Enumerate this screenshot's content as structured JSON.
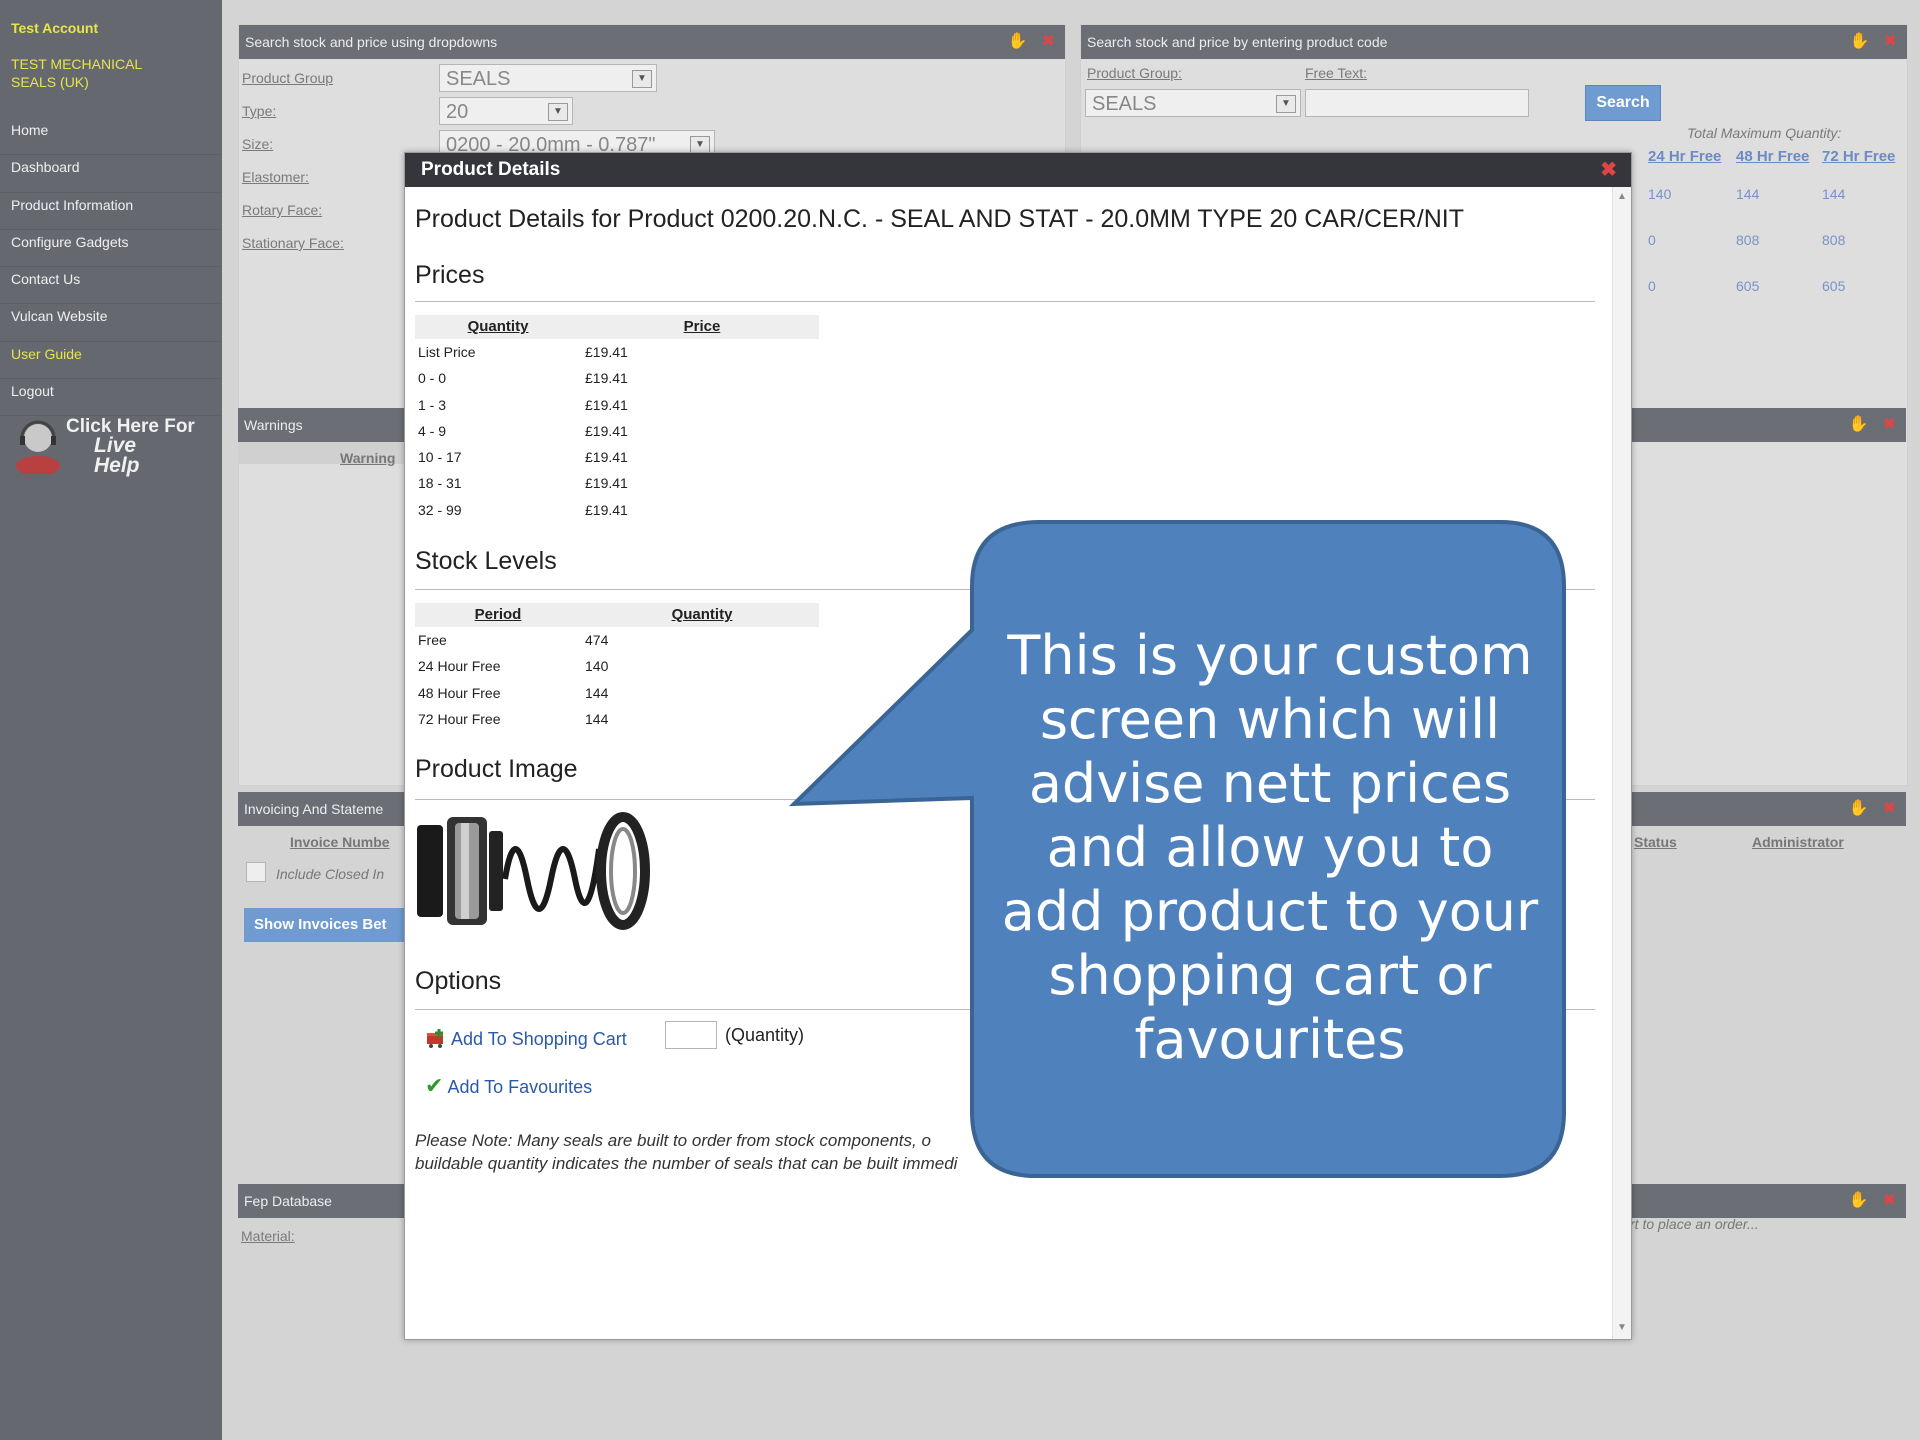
{
  "sidebar": {
    "account": "Test Account",
    "company": "TEST MECHANICAL SEALS (UK)",
    "items": [
      {
        "label": "Home"
      },
      {
        "label": "Dashboard"
      },
      {
        "label": "Product Information"
      },
      {
        "label": "Configure Gadgets"
      },
      {
        "label": "Contact Us"
      },
      {
        "label": "Vulcan Website"
      },
      {
        "label": "User Guide"
      },
      {
        "label": "Logout"
      }
    ],
    "live_help_1": "Click Here For",
    "live_help_2": "Live Help"
  },
  "panel_dropdowns": {
    "title": "Search stock and price using dropdowns",
    "labels": [
      "Product Group",
      "Type:",
      "Size:",
      "Elastomer:",
      "Rotary Face:",
      "Stationary Face:"
    ],
    "product_group": "SEALS",
    "type": "20",
    "size": "0200 - 20.0mm - 0.787\""
  },
  "panel_code": {
    "title": "Search stock and price by entering product code",
    "product_group_label": "Product Group:",
    "free_text_label": "Free Text:",
    "product_group_value": "SEALS",
    "search_button": "Search",
    "total_max_label": "Total Maximum Quantity:",
    "cols": [
      "24 Hr Free",
      "48 Hr Free",
      "72 Hr Free"
    ],
    "rows": [
      [
        "140",
        "144",
        "144"
      ],
      [
        "0",
        "808",
        "808"
      ],
      [
        "0",
        "605",
        "605"
      ]
    ]
  },
  "panel_warnings": {
    "title": "Warnings",
    "col": "Warning"
  },
  "panel_invoicing": {
    "title": "Invoicing And Stateme",
    "col_invoice": "Invoice Numbe",
    "include_closed": "Include Closed In",
    "show_button": "Show Invoices Bet",
    "col_status": "Status",
    "col_admin": "Administrator"
  },
  "panel_fep": {
    "title": "Fep Database",
    "material_label": "Material:",
    "right_text": "rt to place an order..."
  },
  "modal": {
    "title": "Product Details",
    "heading": "Product Details for Product 0200.20.N.C. - SEAL AND STAT - 20.0MM TYPE 20 CAR/CER/NIT",
    "prices_heading": "Prices",
    "price_cols": [
      "Quantity",
      "Price"
    ],
    "prices": [
      [
        "List Price",
        "£19.41"
      ],
      [
        "0 - 0",
        "£19.41"
      ],
      [
        "1 - 3",
        "£19.41"
      ],
      [
        "4 - 9",
        "£19.41"
      ],
      [
        "10 - 17",
        "£19.41"
      ],
      [
        "18 - 31",
        "£19.41"
      ],
      [
        "32 - 99",
        "£19.41"
      ]
    ],
    "stock_heading": "Stock Levels",
    "stock_cols": [
      "Period",
      "Quantity"
    ],
    "stock": [
      [
        "Free",
        "474"
      ],
      [
        "24 Hour Free",
        "140"
      ],
      [
        "48 Hour Free",
        "144"
      ],
      [
        "72 Hour Free",
        "144"
      ]
    ],
    "image_heading": "Product Image",
    "options_heading": "Options",
    "add_cart": "Add To Shopping Cart",
    "quantity_label": "(Quantity)",
    "add_favourites": "Add To Favourites",
    "note_line1": "Please Note: Many seals are built to order from stock components, o",
    "note_line2": "buildable quantity indicates the number of seals that can be built immedi"
  },
  "callout": {
    "text": "This is your custom screen which will advise nett prices and allow you to add product to your shopping cart or favourites",
    "color": "#4f81bd"
  }
}
